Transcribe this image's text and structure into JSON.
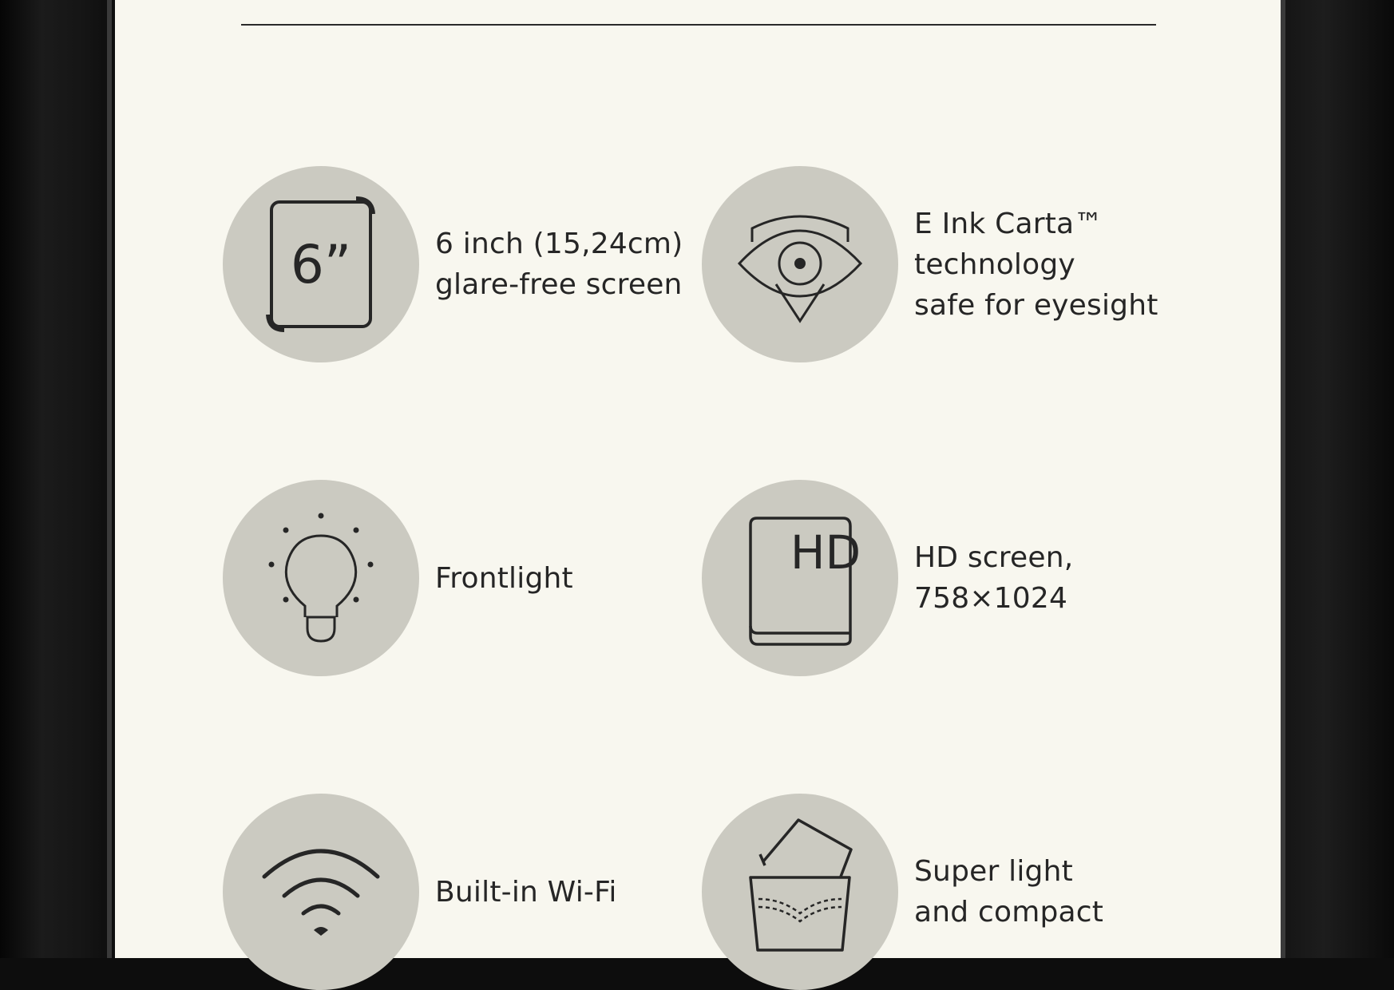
{
  "features": [
    {
      "id": "screen-size",
      "label": "6 inch (15,24cm)\nglare-free screen",
      "icon": "tablet-6-inch-icon",
      "icon_text": "6”"
    },
    {
      "id": "eink",
      "label": "E Ink Carta™\ntechnology\nsafe for eyesight",
      "icon": "eye-shield-icon"
    },
    {
      "id": "frontlight",
      "label": "Frontlight",
      "icon": "lightbulb-icon"
    },
    {
      "id": "hd",
      "label": "HD screen,\n758×1024",
      "icon": "hd-book-icon",
      "icon_text": "HD"
    },
    {
      "id": "wifi",
      "label": "Built-in Wi-Fi",
      "icon": "wifi-icon"
    },
    {
      "id": "light",
      "label": "Super light\nand compact",
      "icon": "pocket-device-icon"
    }
  ],
  "colors": {
    "screen_bg": "#f8f7ef",
    "circle": "#cbcac1",
    "ink": "#262626",
    "bezel": "#0d0d0d"
  }
}
